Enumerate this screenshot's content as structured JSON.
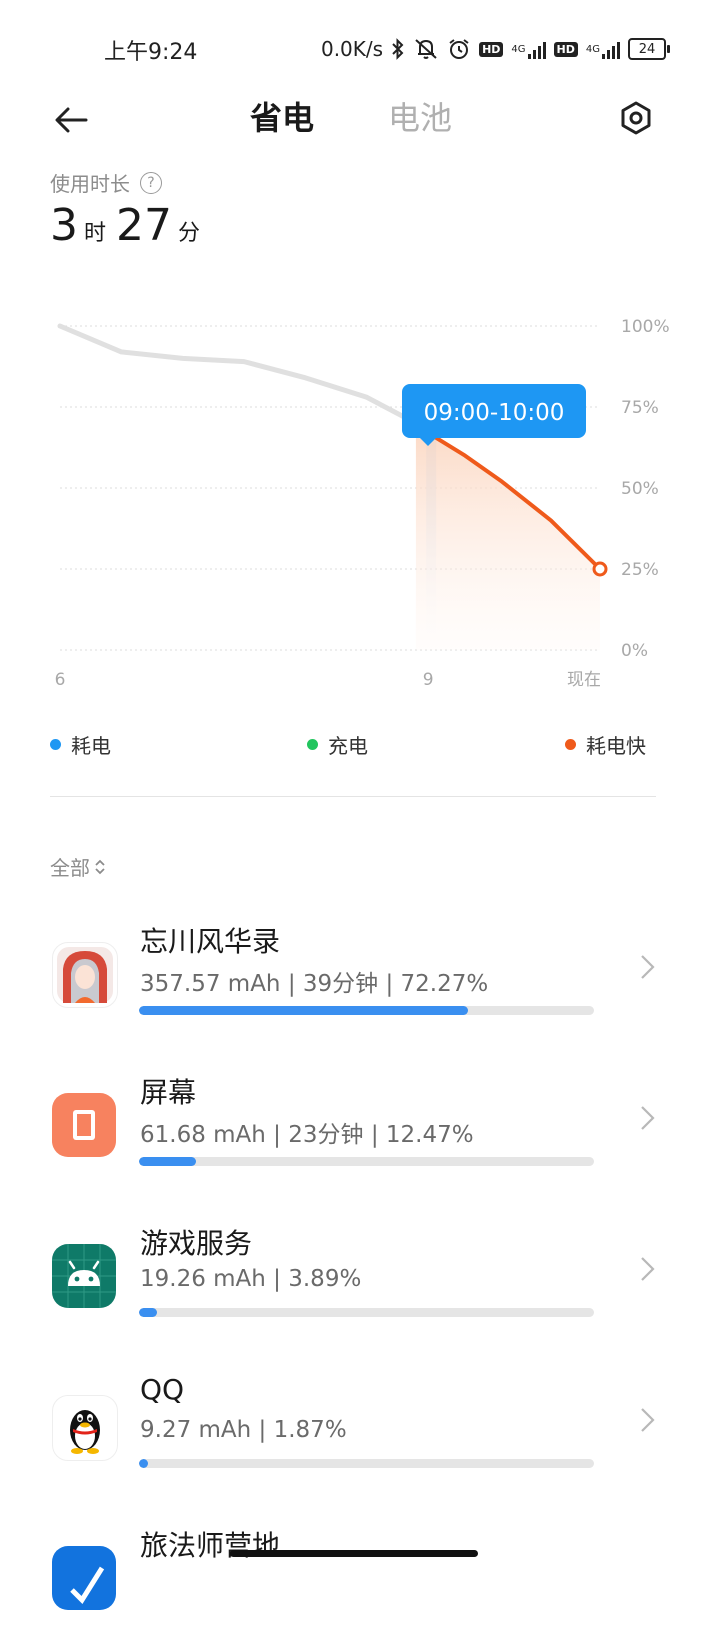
{
  "status_bar": {
    "time": "上午9:24",
    "net_speed": "0.0K/s",
    "hd1": "HD",
    "net1": "4G",
    "hd2": "HD",
    "net2": "4G",
    "battery": "24"
  },
  "header": {
    "tab_active": "省电",
    "tab_inactive": "电池"
  },
  "usage": {
    "label": "使用时长",
    "help": "?",
    "hours": "3",
    "hours_unit": "时",
    "minutes": "27",
    "minutes_unit": "分"
  },
  "chart_data": {
    "type": "line",
    "x_tick_labels": [
      "6",
      "9",
      "现在"
    ],
    "y_tick_labels": [
      "100%",
      "75%",
      "50%",
      "25%",
      "0%"
    ],
    "ylim": [
      0,
      100
    ],
    "x_domain": [
      6.0,
      10.4
    ],
    "series": [
      {
        "name": "耗电",
        "x": [
          6.0,
          6.5,
          7.0,
          7.5,
          8.0,
          8.5,
          8.9
        ],
        "y": [
          100,
          92,
          90,
          89,
          84,
          78,
          70
        ],
        "color": "#e0e0e0"
      },
      {
        "name": "耗电快",
        "x": [
          8.9,
          9.0,
          9.3,
          9.6,
          10.0,
          10.4
        ],
        "y": [
          70,
          67,
          60,
          52,
          40,
          25
        ],
        "color": "#ef5a1b"
      }
    ],
    "selected_range": "09:00-10:00",
    "tooltip_color": "#1e97f3"
  },
  "legend": {
    "consume": "耗电",
    "charge": "充电",
    "fast": "耗电快",
    "colors": {
      "consume": "#1e97f3",
      "charge": "#22c55e",
      "fast": "#ef5a1b"
    }
  },
  "filter": {
    "label": "全部",
    "arrow": "⌃⌄"
  },
  "apps": [
    {
      "name": "忘川风华录",
      "stats": "357.57 mAh | 39分钟 | 72.27%",
      "percent": 72.27
    },
    {
      "name": "屏幕",
      "stats": "61.68 mAh | 23分钟 | 12.47%",
      "percent": 12.47
    },
    {
      "name": "游戏服务",
      "stats": "19.26 mAh | 3.89%",
      "percent": 3.89
    },
    {
      "name": "QQ",
      "stats": "9.27 mAh | 1.87%",
      "percent": 1.87
    },
    {
      "name": "旅法师营地",
      "stats": "",
      "percent": 0
    }
  ]
}
